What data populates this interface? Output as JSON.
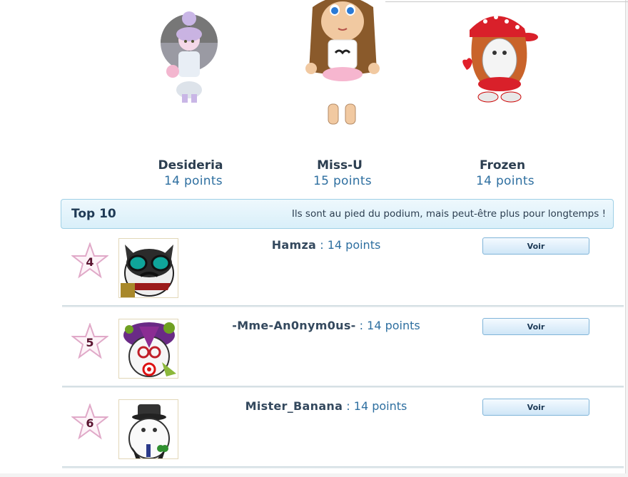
{
  "podium": [
    {
      "name": "Desideria",
      "points": "14 points"
    },
    {
      "name": "Miss-U",
      "points": "15 points"
    },
    {
      "name": "Frozen",
      "points": "14 points"
    }
  ],
  "top10": {
    "title": "Top 10",
    "subtitle": "Ils sont au pied du podium, mais peut-être plus pour longtemps !"
  },
  "rows": [
    {
      "rank": "4",
      "name": "Hamza",
      "sep": " : ",
      "points": "14 points",
      "button": "Voir"
    },
    {
      "rank": "5",
      "name": "-Mme-An0nym0us-",
      "sep": " : ",
      "points": "14 points",
      "button": "Voir"
    },
    {
      "rank": "6",
      "name": "Mister_Banana",
      "sep": " : ",
      "points": "14 points",
      "button": "Voir"
    }
  ]
}
